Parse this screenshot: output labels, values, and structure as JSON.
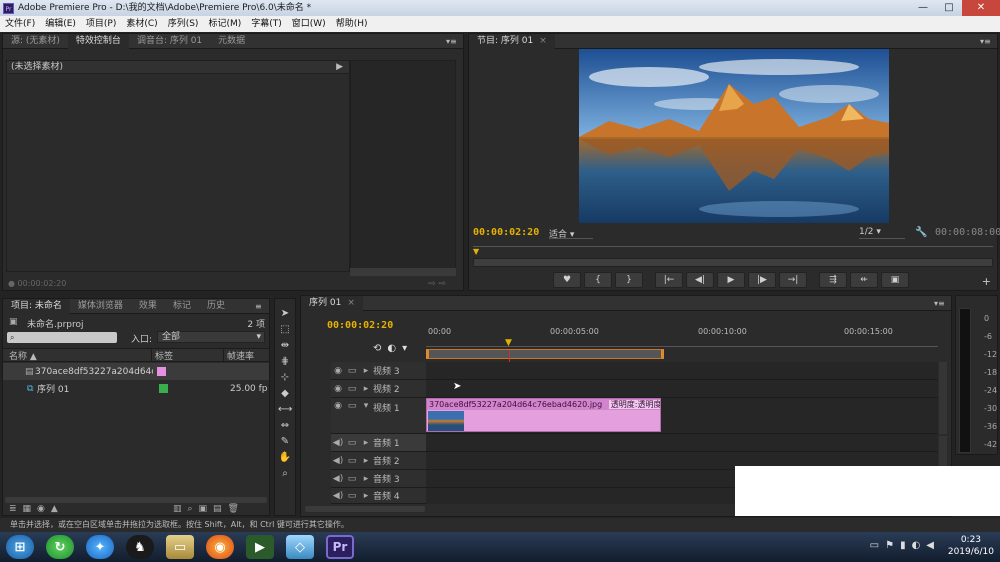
{
  "window": {
    "title": "Adobe Premiere Pro - D:\\我的文档\\Adobe\\Premiere Pro\\6.0\\未命名 *",
    "app_icon": "Pr",
    "buttons": [
      "—",
      "□",
      "✕"
    ]
  },
  "menu": [
    "文件(F)",
    "编辑(E)",
    "项目(P)",
    "素材(C)",
    "序列(S)",
    "标记(M)",
    "字幕(T)",
    "窗口(W)",
    "帮助(H)"
  ],
  "source_panel": {
    "tabs": [
      "源: (无素材)",
      "特效控制台",
      "调音台: 序列 01",
      "元数据"
    ],
    "active_tab": 1,
    "no_clip": "(未选择素材)",
    "timecode": "00:00:02:20"
  },
  "program_panel": {
    "tab": "节目: 序列 01",
    "timecode": "00:00:02:20",
    "fit": "适合",
    "resolution": "1/2",
    "duration": "00:00:08:00",
    "transport": [
      "♥",
      "{",
      "}",
      "|←",
      "◀|",
      "▶",
      "|▶",
      "→|",
      "⇶",
      "⇷",
      "▣"
    ]
  },
  "project_panel": {
    "tabs": [
      "项目: 未命名",
      "媒体浏览器",
      "效果",
      "标记",
      "历史"
    ],
    "project_file": "未命名.prproj",
    "item_count": "2 项",
    "search_placeholder": "",
    "entry_label": "入口:",
    "entry_value": "全部",
    "columns": [
      "名称",
      "标签",
      "帧速率"
    ],
    "items": [
      {
        "name": "370ace8df53227a204d64c7",
        "label_color": "#e78fe0",
        "fps": ""
      },
      {
        "name": "序列 01",
        "label_color": "#3aae4c",
        "fps": "25.00 fp"
      }
    ]
  },
  "timeline": {
    "tab": "序列 01",
    "timecode": "00:00:02:20",
    "ruler": [
      "00:00",
      "00:00:05:00",
      "00:00:10:00",
      "00:00:15:00"
    ],
    "tracks": [
      {
        "name": "视频 3",
        "type": "video"
      },
      {
        "name": "视频 2",
        "type": "video"
      },
      {
        "name": "视频 1",
        "type": "video",
        "expanded": true
      },
      {
        "name": "音频 1",
        "type": "audio"
      },
      {
        "name": "音频 2",
        "type": "audio"
      },
      {
        "name": "音频 3",
        "type": "audio"
      },
      {
        "name": "音频 4",
        "type": "audio"
      }
    ],
    "clip": {
      "name": "370ace8df53227a204d64c76ebad4620.jpg",
      "effect": "透明度:透明度▾"
    }
  },
  "meter": {
    "labels": [
      "0",
      "-6",
      "-12",
      "-18",
      "-24",
      "-30",
      "-36",
      "-42"
    ]
  },
  "status": {
    "text": "单击并选择，或在空白区域单击并拖拉为选取框。按住 Shift，Alt，和 Ctrl 键可进行其它操作。"
  },
  "taskbar": {
    "time": "0:23",
    "date": "2019/6/10"
  }
}
